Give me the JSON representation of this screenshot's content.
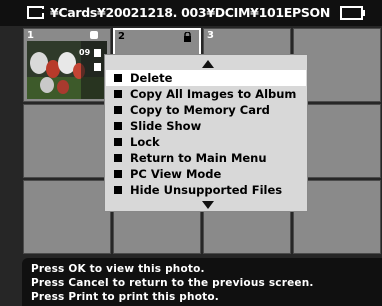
{
  "header": {
    "path": "¥Cards¥20021218. 003¥DCIM¥101EPSON",
    "card_icon": "memory-card-icon",
    "battery_icon": "battery-icon"
  },
  "thumbnails": [
    {
      "number": "1",
      "photo": "tulips",
      "badges": [
        "lock-icon",
        "print-icon",
        "copy-icon"
      ],
      "count": "09"
    },
    {
      "number": "2",
      "selected": true,
      "badges": [
        "lock-icon"
      ]
    },
    {
      "number": "3"
    }
  ],
  "menu": {
    "items": [
      {
        "label": "Delete",
        "highlighted": true
      },
      {
        "label": "Copy All Images to Album"
      },
      {
        "label": "Copy to Memory Card"
      },
      {
        "label": "Slide Show"
      },
      {
        "label": "Lock"
      },
      {
        "label": "Return to Main Menu"
      },
      {
        "label": "PC View Mode"
      },
      {
        "label": "Hide Unsupported Files"
      }
    ],
    "scroll_up_icon": "triangle-up-icon",
    "scroll_down_icon": "triangle-down-icon"
  },
  "footer": {
    "lines": [
      "Press OK to view this photo.",
      "Press Cancel to return to the previous screen.",
      "Press Print to print this photo."
    ]
  },
  "colors": {
    "background": "#262626",
    "bar": "#101010",
    "cell": "#8a8a8a",
    "menu": "#d8d8d8",
    "highlight": "#ffffff"
  }
}
